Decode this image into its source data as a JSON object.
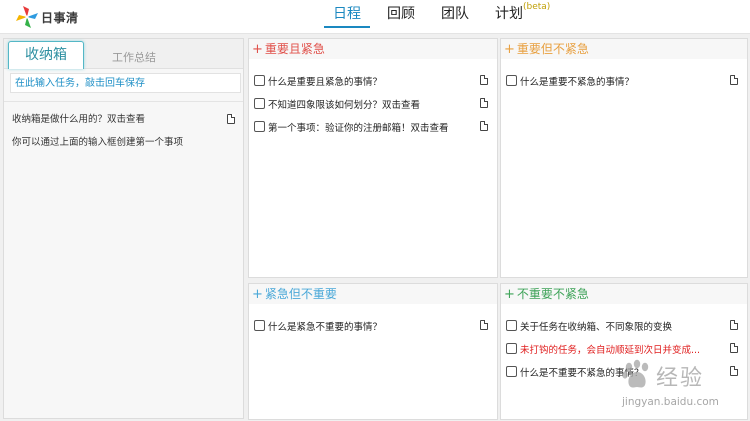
{
  "app": {
    "logo_text": "日事清"
  },
  "nav": {
    "items": [
      {
        "label": "日程",
        "active": true
      },
      {
        "label": "回顾",
        "active": false
      },
      {
        "label": "团队",
        "active": false
      },
      {
        "label": "计划",
        "active": false,
        "suffix": "(beta)"
      }
    ]
  },
  "inbox": {
    "tab_active": "收纳箱",
    "tab_inactive": "工作总结",
    "input_placeholder": "在此输入任务，敲击回车保存",
    "items": [
      {
        "text": "收纳箱是做什么用的？双击查看",
        "has_doc": true
      },
      {
        "text": "你可以通过上面的输入框创建第一个事项",
        "has_doc": false
      }
    ]
  },
  "quadrants": {
    "q1": {
      "title": "重要且紧急",
      "tasks": [
        {
          "text": "什么是重要且紧急的事情？"
        },
        {
          "text": "不知道四象限该如何划分？双击查看"
        },
        {
          "text": "第一个事项：验证你的注册邮箱！双击查看"
        }
      ]
    },
    "q2": {
      "title": "重要但不紧急",
      "tasks": [
        {
          "text": "什么是重要不紧急的事情？"
        }
      ]
    },
    "q3": {
      "title": "紧急但不重要",
      "tasks": [
        {
          "text": "什么是紧急不重要的事情？"
        }
      ]
    },
    "q4": {
      "title": "不重要不紧急",
      "tasks": [
        {
          "text": "关于任务在收纳箱、不同象限的变换"
        },
        {
          "text": "未打钩的任务，会自动顺延到次日并变成...",
          "red": true
        },
        {
          "text": "什么是不重要不紧急的事情？"
        }
      ]
    }
  },
  "watermark": {
    "text": "经验",
    "url": "jingyan.baidu.com"
  },
  "colors": {
    "accent": "#1a88c0",
    "q1": "#e0504a",
    "q2": "#e8a040",
    "q3": "#4aa8d8",
    "q4": "#3ea358",
    "overdue": "#e02020"
  },
  "icons": {
    "logo": "pinwheel-logo-icon",
    "task_note": "document-icon",
    "add": "plus-icon"
  }
}
